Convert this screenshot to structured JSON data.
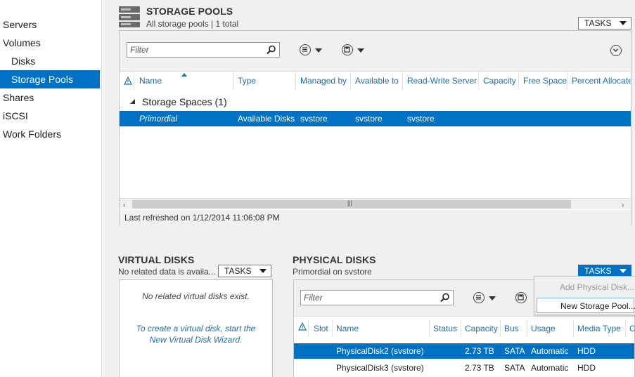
{
  "nav": {
    "items": [
      {
        "label": "Servers",
        "sub": false,
        "selected": false
      },
      {
        "label": "Volumes",
        "sub": false,
        "selected": false
      },
      {
        "label": "Disks",
        "sub": true,
        "selected": false
      },
      {
        "label": "Storage Pools",
        "sub": true,
        "selected": true
      },
      {
        "label": "Shares",
        "sub": false,
        "selected": false
      },
      {
        "label": "iSCSI",
        "sub": false,
        "selected": false
      },
      {
        "label": "Work Folders",
        "sub": false,
        "selected": false
      }
    ]
  },
  "storage_pools": {
    "title": "STORAGE POOLS",
    "subtitle": "All storage pools | 1 total",
    "tasks_label": "TASKS",
    "filter_placeholder": "Filter",
    "columns": [
      "Name",
      "Type",
      "Managed by",
      "Available to",
      "Read-Write Server",
      "Capacity",
      "Free Space",
      "Percent Allocate"
    ],
    "group_label": "Storage Spaces (1)",
    "row": {
      "name": "Primordial",
      "type": "Available Disks",
      "managed_by": "svstore",
      "available_to": "svstore",
      "rw_server": "svstore"
    },
    "status": "Last refreshed on 1/12/2014 11:06:08 PM"
  },
  "virtual_disks": {
    "title": "VIRTUAL DISKS",
    "subtitle": "No related data is availa...",
    "tasks_label": "TASKS",
    "empty_message": "No related virtual disks exist.",
    "hint_line1": "To create a virtual disk, start the",
    "hint_line2": "New Virtual Disk Wizard."
  },
  "physical_disks": {
    "title": "PHYSICAL DISKS",
    "subtitle": "Primordial on svstore",
    "tasks_label": "TASKS",
    "filter_placeholder": "Filter",
    "columns": [
      "Slot",
      "Name",
      "Status",
      "Capacity",
      "Bus",
      "Usage",
      "Media Type",
      "C"
    ],
    "rows": [
      {
        "name": "PhysicalDisk2 (svstore)",
        "capacity": "2.73 TB",
        "bus": "SATA",
        "usage": "Automatic",
        "media": "HDD"
      },
      {
        "name": "PhysicalDisk3 (svstore)",
        "capacity": "2.73 TB",
        "bus": "SATA",
        "usage": "Automatic",
        "media": "HDD"
      }
    ]
  },
  "tasks_menu": {
    "items": [
      "Add Physical Disk...",
      "New Storage Pool..."
    ]
  },
  "colors": {
    "accent": "#0072c6",
    "link": "#1f6fb2"
  }
}
